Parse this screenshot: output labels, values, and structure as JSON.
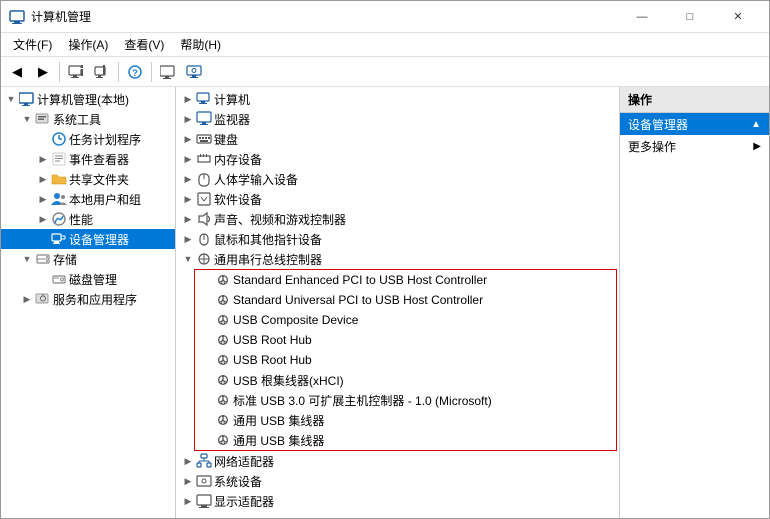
{
  "window": {
    "title": "计算机管理",
    "controls": {
      "minimize": "—",
      "maximize": "□",
      "close": "✕"
    }
  },
  "menubar": {
    "items": [
      {
        "label": "文件(F)"
      },
      {
        "label": "操作(A)"
      },
      {
        "label": "查看(V)"
      },
      {
        "label": "帮助(H)"
      }
    ]
  },
  "toolbar": {
    "buttons": [
      "◀",
      "▶",
      "⬛",
      "⬛",
      "❓",
      "⬛",
      "🖥"
    ]
  },
  "tree": {
    "root_label": "计算机管理(本地)",
    "items": [
      {
        "label": "系统工具",
        "level": 1,
        "expanded": true,
        "icon": "gear"
      },
      {
        "label": "任务计划程序",
        "level": 2,
        "icon": "clock"
      },
      {
        "label": "事件查看器",
        "level": 2,
        "icon": "event"
      },
      {
        "label": "共享文件夹",
        "level": 2,
        "icon": "folder"
      },
      {
        "label": "本地用户和组",
        "level": 2,
        "icon": "users"
      },
      {
        "label": "性能",
        "level": 2,
        "icon": "perf"
      },
      {
        "label": "设备管理器",
        "level": 2,
        "icon": "device",
        "selected": true
      },
      {
        "label": "存储",
        "level": 1,
        "expanded": true,
        "icon": "storage"
      },
      {
        "label": "磁盘管理",
        "level": 2,
        "icon": "disk"
      },
      {
        "label": "服务和应用程序",
        "level": 1,
        "icon": "service"
      }
    ]
  },
  "devices": {
    "categories": [
      {
        "label": "计算机",
        "level": 0,
        "expanded": false
      },
      {
        "label": "监视器",
        "level": 0,
        "expanded": false
      },
      {
        "label": "键盘",
        "level": 0,
        "expanded": false
      },
      {
        "label": "内存设备",
        "level": 0,
        "expanded": false
      },
      {
        "label": "人体学输入设备",
        "level": 0,
        "expanded": false
      },
      {
        "label": "软件设备",
        "level": 0,
        "expanded": false
      },
      {
        "label": "声音、视频和游戏控制器",
        "level": 0,
        "expanded": false
      },
      {
        "label": "鼠标和其他指针设备",
        "level": 0,
        "expanded": false
      },
      {
        "label": "通用串行总线控制器",
        "level": 0,
        "expanded": true
      },
      {
        "label": "网络适配器",
        "level": 0,
        "expanded": false
      },
      {
        "label": "系统设备",
        "level": 0,
        "expanded": false
      },
      {
        "label": "显示适配器",
        "level": 0,
        "expanded": false
      }
    ],
    "usb_children": [
      {
        "label": "Standard Enhanced PCI to USB Host Controller"
      },
      {
        "label": "Standard Universal PCI to USB Host Controller"
      },
      {
        "label": "USB Composite Device"
      },
      {
        "label": "USB Root Hub"
      },
      {
        "label": "USB Root Hub"
      },
      {
        "label": "USB 根集线器(xHCI)"
      },
      {
        "label": "标准 USB 3.0 可扩展主机控制器 - 1.0 (Microsoft)"
      },
      {
        "label": "通用 USB 集线器"
      },
      {
        "label": "通用 USB 集线器"
      }
    ]
  },
  "actions": {
    "header": "操作",
    "items": [
      {
        "label": "设备管理器",
        "has_arrow": true,
        "selected": true
      },
      {
        "label": "更多操作",
        "has_arrow": true
      }
    ]
  }
}
